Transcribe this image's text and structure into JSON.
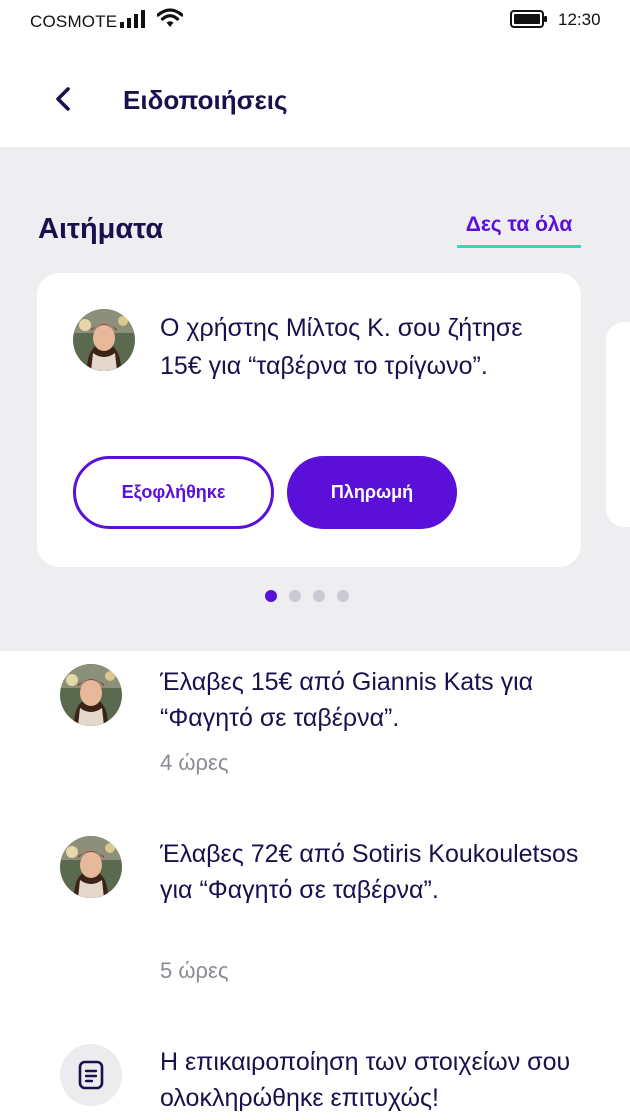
{
  "status_bar": {
    "carrier": "COSMOTE",
    "time": "12:30"
  },
  "header": {
    "title": "Ειδοποιήσεις"
  },
  "requests": {
    "title": "Αιτήματα",
    "see_all": "Δες τα όλα",
    "card": {
      "text": "Ο χρήστης Μίλτος Κ. σου ζήτησε 15€ για “ταβέρνα το τρίγωνο”.",
      "paid_button": "Εξοφλήθηκε",
      "pay_button": "Πληρωμή"
    },
    "pagination": {
      "total": 4,
      "active": 1
    }
  },
  "feed": [
    {
      "text": "Έλαβες 15€ από Giannis Kats για “Φαγητό σε ταβέρνα”.",
      "time": "4 ώρες"
    },
    {
      "text": "Έλαβες 72€ από Sotiris Koukouletsos για “Φαγητό σε ταβέρνα”.",
      "time": "5 ώρες"
    },
    {
      "text": "Η επικαιροποίηση των στοιχείων σου ολοκληρώθηκε επιτυχώς!"
    }
  ],
  "colors": {
    "brand": "#5a10d8",
    "accent_underline": "#33d9b6",
    "text_primary": "#1c0f4d",
    "text_muted": "#8a8a95",
    "panel_bg": "#eeeef1"
  },
  "icons": {
    "back": "chevron-left-icon",
    "signal": "signal-icon",
    "wifi": "wifi-icon",
    "battery": "battery-icon",
    "document": "document-icon"
  }
}
